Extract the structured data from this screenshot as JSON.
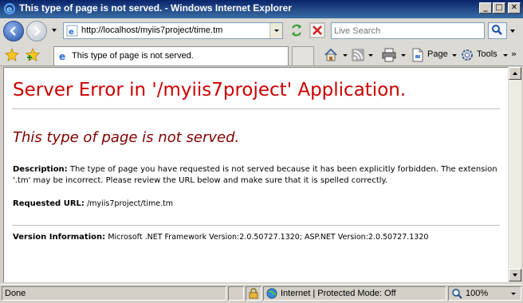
{
  "window": {
    "title": "This type of page is not served. - Windows Internet Explorer",
    "minimize": "_",
    "maximize": "□",
    "close": "✕"
  },
  "address": {
    "url": "http://localhost/myiis7project/time.tm",
    "search_placeholder": "Live Search"
  },
  "tab": {
    "label": "This type of page is not served."
  },
  "commands": {
    "page": "Page",
    "tools": "Tools"
  },
  "page": {
    "heading": "Server Error in '/myiis7project' Application.",
    "subheading": "This type of page is not served.",
    "description_label": "Description:",
    "description_text": "The type of page you have requested is not served because it has been explicitly forbidden.  The extension '.tm' may be incorrect.   Please review the URL below and make sure that it is spelled correctly.",
    "requested_url_label": "Requested URL:",
    "requested_url": "/myiis7project/time.tm",
    "version_label": "Version Information:",
    "version_text": "Microsoft .NET Framework Version:2.0.50727.1320; ASP.NET Version:2.0.50727.1320"
  },
  "status": {
    "left": "Done",
    "zone": "Internet | Protected Mode: Off",
    "zoom": "100%"
  },
  "colors": {
    "heading": "#cc0000",
    "subheading": "#800000"
  },
  "icons": [
    "ie-logo-icon",
    "back-icon",
    "forward-icon",
    "refresh-icon",
    "stop-icon",
    "search-icon",
    "favorites-star-icon",
    "add-favorites-icon",
    "home-icon",
    "feeds-icon",
    "print-icon",
    "page-icon",
    "tools-gear-icon",
    "globe-icon",
    "zoom-icon",
    "lock-icon"
  ]
}
